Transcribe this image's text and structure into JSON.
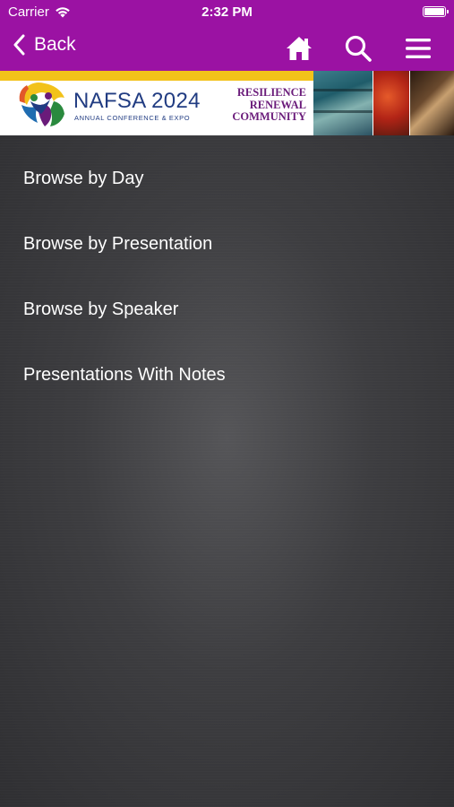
{
  "status_bar": {
    "carrier": "Carrier",
    "time": "2:32 PM"
  },
  "nav": {
    "back_label": "Back",
    "icons": [
      "home-icon",
      "search-icon",
      "hamburger-menu-icon"
    ],
    "bar_color": "#9b12a3"
  },
  "banner": {
    "brand": "NAFSA 2024",
    "subtitle": "ANNUAL CONFERENCE & EXPO",
    "taglines": [
      "RESILIENCE",
      "RENEWAL",
      "COMMUNITY"
    ]
  },
  "menu": {
    "items": [
      {
        "label": "Browse by Day"
      },
      {
        "label": "Browse by Presentation"
      },
      {
        "label": "Browse by Speaker"
      },
      {
        "label": "Presentations With Notes"
      }
    ]
  }
}
